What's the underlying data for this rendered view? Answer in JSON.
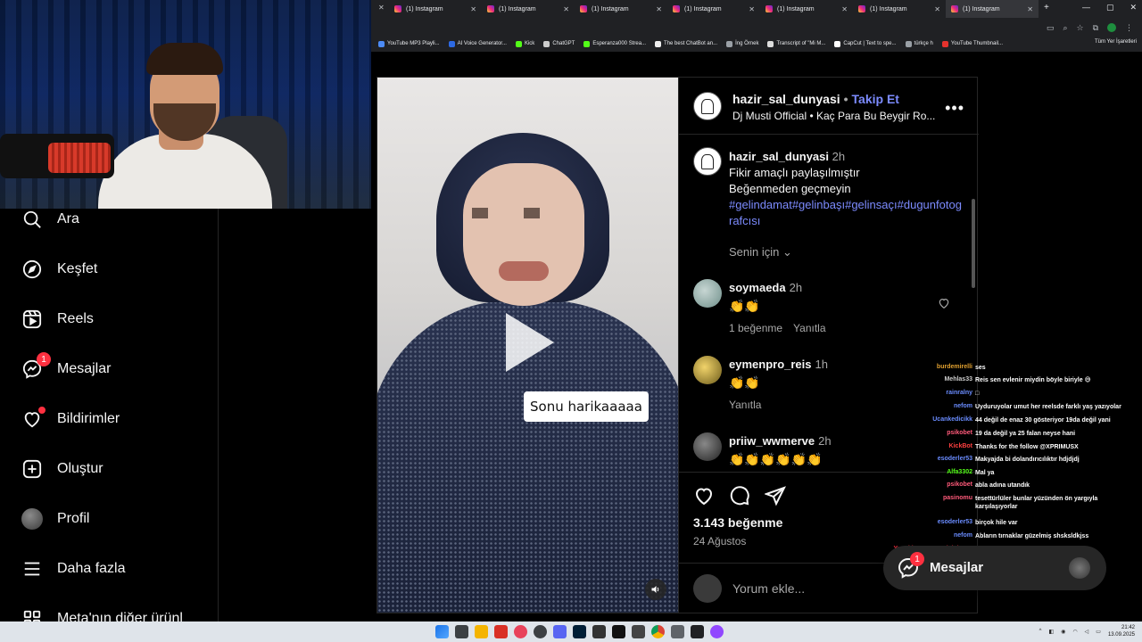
{
  "browser": {
    "tabs": [
      {
        "title": "(1) Instagram"
      },
      {
        "title": "(1) Instagram"
      },
      {
        "title": "(1) Instagram"
      },
      {
        "title": "(1) Instagram"
      },
      {
        "title": "(1) Instagram"
      },
      {
        "title": "(1) Instagram"
      },
      {
        "title": "(1) Instagram"
      }
    ],
    "new_tab": "+",
    "bookmarks": [
      {
        "label": "YouTube MP3 Playli...",
        "color": "#4c8bf5"
      },
      {
        "label": "AI Voice Generator...",
        "color": "#2d6ae3"
      },
      {
        "label": "Kick",
        "color": "#53fc18"
      },
      {
        "label": "ChatGPT",
        "color": "#cccccc"
      },
      {
        "label": "Esperanza000 Strea...",
        "color": "#53fc18"
      },
      {
        "label": "The best ChatBot an...",
        "color": "#eeeeee"
      },
      {
        "label": "İng Örnek",
        "color": "#9aa0a6"
      },
      {
        "label": "Transcript of \"Mi M...",
        "color": "#dddddd"
      },
      {
        "label": "CapCut | Text to spe...",
        "color": "#ffffff"
      },
      {
        "label": "türkçe h",
        "color": "#9aa0a6"
      },
      {
        "label": "YouTube Thumbnail...",
        "color": "#e5322d"
      }
    ],
    "all_bookmarks": "Tüm Yer İşaretleri"
  },
  "nav": {
    "items": [
      {
        "label": "Ara",
        "icon": "search-icon"
      },
      {
        "label": "Keşfet",
        "icon": "compass-icon"
      },
      {
        "label": "Reels",
        "icon": "reels-icon"
      },
      {
        "label": "Mesajlar",
        "icon": "messenger-icon",
        "badge": "1"
      },
      {
        "label": "Bildirimler",
        "icon": "heart-icon"
      },
      {
        "label": "Oluştur",
        "icon": "plus-square-icon"
      },
      {
        "label": "Profil",
        "icon": "avatar"
      },
      {
        "label": "Daha fazla",
        "icon": "menu-icon"
      },
      {
        "label": "Meta'nın diğer ürünl",
        "icon": "meta-icon"
      }
    ]
  },
  "post": {
    "username": "hazir_sal_dunyasi",
    "separator": "•",
    "follow_label": "Takip Et",
    "audio": "Dj Musti Official • Kaç Para Bu Beygir Ro...",
    "video_caption": "Sonu harikaaaaa",
    "caption": {
      "username": "hazir_sal_dunyasi",
      "time": "2h",
      "line1": "Fikir amaçlı paylaşılmıştır",
      "line2": "Beğenmeden geçmeyin",
      "hashtags": "#gelindamat#gelinbaşı#gelinsaçı#dugunfotografcısı"
    },
    "for_you": "Senin için",
    "comments": [
      {
        "user": "soymaeda",
        "time": "2h",
        "text": "👏👏",
        "likes": "1 beğenme",
        "reply": "Yanıtla"
      },
      {
        "user": "eymenpro_reis",
        "time": "1h",
        "text": "👏👏",
        "likes": "",
        "reply": "Yanıtla"
      },
      {
        "user": "priiw_wwmerve",
        "time": "2h",
        "text": "👏👏👏👏👏👏",
        "likes": "",
        "reply": ""
      }
    ],
    "likes": "3.143 beğenme",
    "date": "24 Ağustos",
    "comment_placeholder": "Yorum ekle..."
  },
  "stream_chat": [
    {
      "user": "burdemirelli",
      "msg": "ses",
      "color": "#e0a030"
    },
    {
      "user": "Mehlas33",
      "msg": "Reis sen evlenir miydin böyle biriyle 😅",
      "color": "#cccccc"
    },
    {
      "user": "rainralny",
      "msg": "□",
      "color": "#6a8cff"
    },
    {
      "user": "nefom",
      "msg": "Uyduruyolar umut her reelsde farklı yaş yazıyolar",
      "color": "#6a8cff"
    },
    {
      "user": "Ucankedicikk",
      "msg": "44 değil de enaz 30 gösteriyor 19da değil yani",
      "color": "#6a8cff"
    },
    {
      "user": "psikobet",
      "msg": "19 da değil ya 25 falan neyse hani",
      "color": "#ff5a7a"
    },
    {
      "user": "KickBot",
      "msg": "Thanks for the follow @XPRIMUSX",
      "color": "#ff4040"
    },
    {
      "user": "esoderler53",
      "msg": "Makyajda bi dolandırıcılıktır hdjdjdj",
      "color": "#6a8cff"
    },
    {
      "user": "Alfa3302",
      "msg": "Mal ya",
      "color": "#53fc18"
    },
    {
      "user": "psikobet",
      "msg": "abla adına utandık",
      "color": "#ff5a7a"
    },
    {
      "user": "pasinomu",
      "msg": "tesettürlüler bunlar yüzünden ön yargıyla karşılaşıyorlar",
      "color": "#ff5a7a"
    },
    {
      "user": "esoderler53",
      "msg": "birçok hile var",
      "color": "#6a8cff"
    },
    {
      "user": "nefom",
      "msg": "Abların tırnaklar güzelmiş shsksldkjss",
      "color": "#6a8cff"
    },
    {
      "user": "YuzukluSumurtaYiyici3000",
      "msg": "sıkıntı sende değil beynim eridi",
      "color": "#ff3040"
    }
  ],
  "messages_bar": {
    "label": "Mesajlar",
    "badge": "1"
  },
  "taskbar": {
    "time": "21:42",
    "date": "13.09.2025"
  }
}
